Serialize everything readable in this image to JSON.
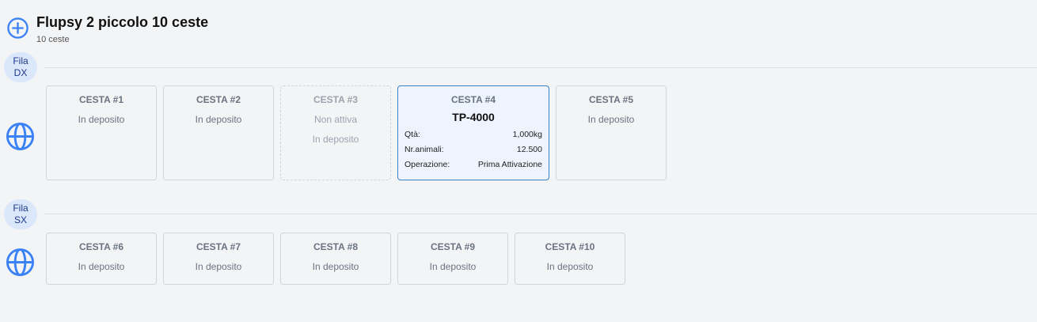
{
  "header": {
    "title": "Flupsy 2 piccolo 10 ceste",
    "subtitle": "10 ceste"
  },
  "rows": {
    "dx": {
      "label_line1": "Fila",
      "label_line2": "DX"
    },
    "sx": {
      "label_line1": "Fila",
      "label_line2": "SX"
    }
  },
  "baskets": {
    "c1": {
      "name": "CESTA #1",
      "status": "In deposito"
    },
    "c2": {
      "name": "CESTA #2",
      "status": "In deposito"
    },
    "c3": {
      "name": "CESTA #3",
      "status": "Non attiva",
      "status2": "In deposito"
    },
    "c4": {
      "name": "CESTA #4",
      "code": "TP-4000",
      "qty_label": "Qtà:",
      "qty_value": "1,000kg",
      "animals_label": "Nr.animali:",
      "animals_value": "12.500",
      "op_label": "Operazione:",
      "op_value": "Prima Attivazione"
    },
    "c5": {
      "name": "CESTA #5",
      "status": "In deposito"
    },
    "c6": {
      "name": "CESTA #6",
      "status": "In deposito"
    },
    "c7": {
      "name": "CESTA #7",
      "status": "In deposito"
    },
    "c8": {
      "name": "CESTA #8",
      "status": "In deposito"
    },
    "c9": {
      "name": "CESTA #9",
      "status": "In deposito"
    },
    "c10": {
      "name": "CESTA #10",
      "status": "In deposito"
    }
  },
  "colors": {
    "accent": "#3b82f6",
    "badge_bg": "#dbe7fb",
    "active_border": "#3b82c4"
  },
  "icons": {
    "header": "plus-circle-icon",
    "row": "globe-icon"
  }
}
